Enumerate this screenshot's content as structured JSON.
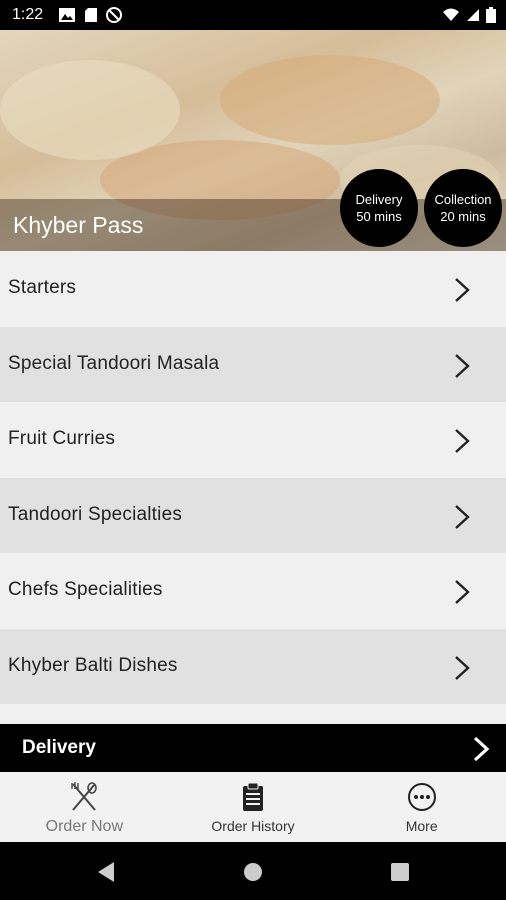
{
  "status_bar": {
    "time": "1:22",
    "left_icons": [
      "gallery-icon",
      "sd-card-icon",
      "do-not-disturb-icon"
    ],
    "right_icons": [
      "wifi-icon",
      "signal-icon",
      "battery-icon"
    ]
  },
  "hero": {
    "restaurant_name": "Khyber Pass",
    "delivery_badge": {
      "label": "Delivery",
      "time": "50 mins"
    },
    "collection_badge": {
      "label": "Collection",
      "time": "20 mins"
    }
  },
  "menu": {
    "categories": [
      {
        "label": "Starters"
      },
      {
        "label": "Special Tandoori Masala"
      },
      {
        "label": "Fruit Curries"
      },
      {
        "label": "Tandoori Specialties"
      },
      {
        "label": "Chefs Specialities"
      },
      {
        "label": "Khyber Balti Dishes"
      }
    ]
  },
  "delivery_bar": {
    "label": "Delivery"
  },
  "bottom_nav": {
    "items": [
      {
        "label": "Order Now",
        "icon": "fork-spoon-icon",
        "active": true
      },
      {
        "label": "Order History",
        "icon": "clipboard-icon",
        "active": false
      },
      {
        "label": "More",
        "icon": "more-icon",
        "active": false
      }
    ]
  },
  "colors": {
    "accent": "#000000",
    "row_light": "#f0f0f0",
    "row_dark": "#e1e1e1"
  }
}
